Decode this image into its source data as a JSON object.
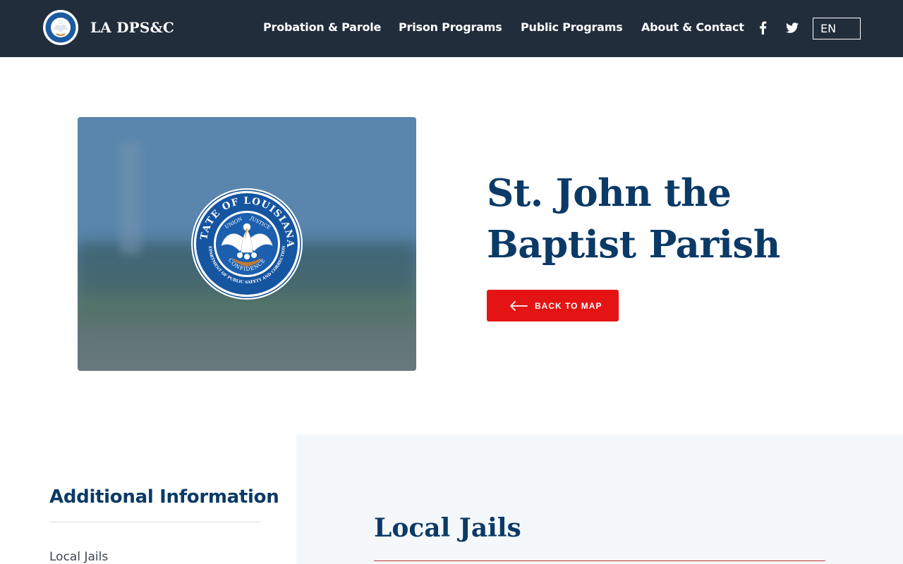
{
  "header": {
    "brand": "LA DPS&C",
    "nav": [
      "Probation & Parole",
      "Prison Programs",
      "Public Programs",
      "About & Contact"
    ],
    "social_icons": [
      "facebook-icon",
      "twitter-icon"
    ],
    "language": "EN"
  },
  "hero": {
    "title_line1": "St. John the",
    "title_line2": "Baptist Parish",
    "back_label": "BACK TO MAP",
    "seal": {
      "top_text": "STATE OF LOUISIANA",
      "motto_left": "UNION",
      "motto_right": "JUSTICE",
      "motto_bottom": "CONFIDENCE",
      "dept_text": "DEPARTMENT OF PUBLIC SAFETY AND CORRECTIONS"
    }
  },
  "sidebar": {
    "title": "Additional Information",
    "links": [
      "Local Jails"
    ]
  },
  "main": {
    "section_title": "Local Jails"
  },
  "colors": {
    "header_bg": "#222d3c",
    "navy": "#0b3a66",
    "accent_red": "#e41414",
    "panel_bg": "#f5f8fb"
  }
}
